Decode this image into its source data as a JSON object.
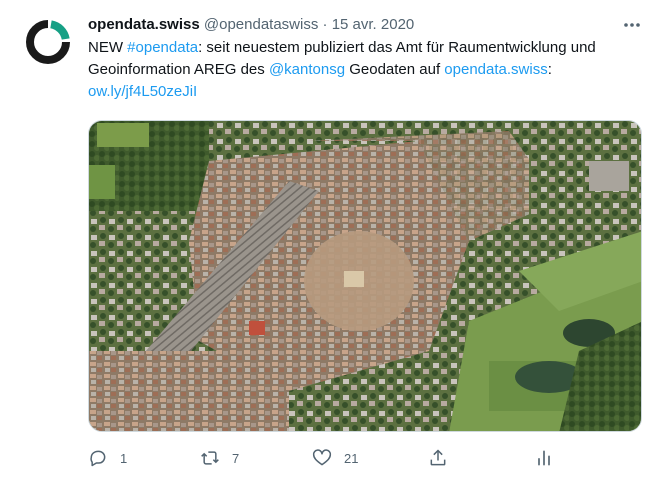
{
  "author": {
    "name": "opendata.swiss",
    "handle": "@opendataswiss",
    "separator": "·",
    "date": "15 avr. 2020"
  },
  "tweet_text": {
    "part1": "NEW ",
    "hashtag": "#opendata",
    "part2": ": seit neuestem publiziert das Amt für Raumentwicklung und Geoinformation AREG des ",
    "mention": "@kantonsg",
    "part3": " Geodaten auf ",
    "link1": "opendata.swiss",
    "part4": ": ",
    "link2": "ow.ly/jf4L50zeJiI"
  },
  "actions": {
    "reply_count": "1",
    "retweet_count": "7",
    "like_count": "21"
  },
  "icons": {
    "avatar": "opendata-logo",
    "more": "more-icon",
    "reply": "reply-icon",
    "retweet": "retweet-icon",
    "like": "heart-icon",
    "share": "share-icon",
    "analytics": "analytics-icon"
  },
  "colors": {
    "link": "#1d9bf0",
    "secondary_text": "#536471",
    "logo_teal": "#16a085",
    "logo_dark": "#1a1a1a"
  }
}
